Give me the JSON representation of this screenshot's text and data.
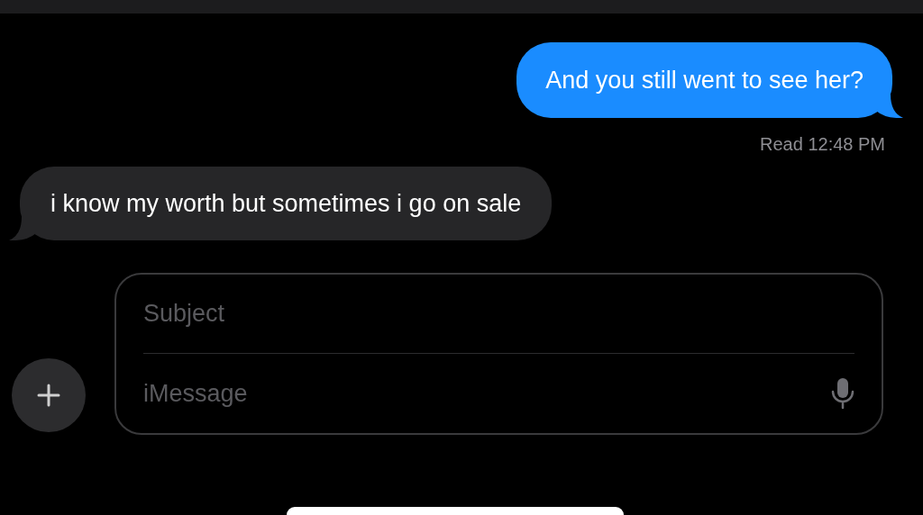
{
  "messages": [
    {
      "kind": "sent",
      "text": "And you still went to see her?"
    },
    {
      "kind": "receipt",
      "text": "Read 12:48 PM"
    },
    {
      "kind": "received",
      "text": "i know my worth but sometimes i go on sale"
    }
  ],
  "composer": {
    "subject": {
      "placeholder": "Subject"
    },
    "message": {
      "placeholder": "iMessage"
    }
  }
}
